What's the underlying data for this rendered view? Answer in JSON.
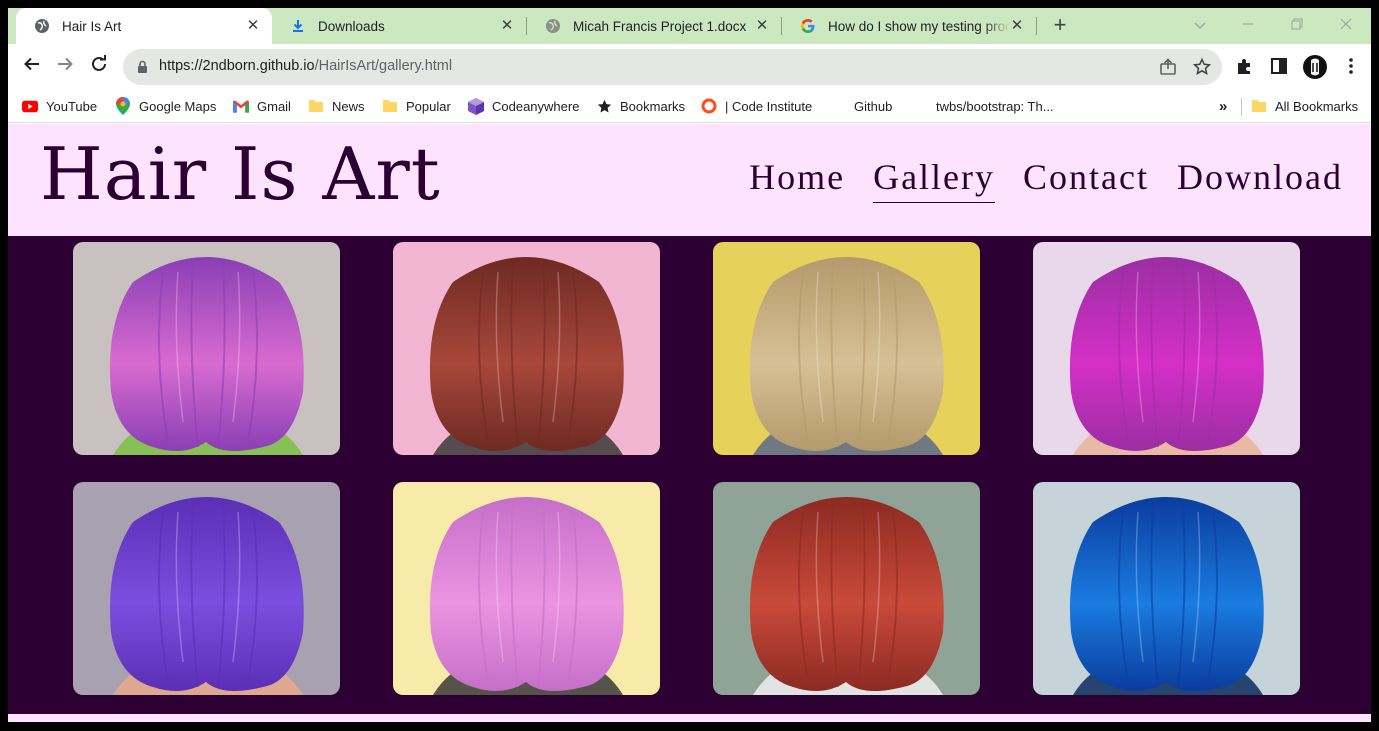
{
  "browser": {
    "tabs": [
      {
        "title": "Hair Is Art",
        "icon": "globe-icon",
        "active": true
      },
      {
        "title": "Downloads",
        "icon": "download-icon",
        "active": false
      },
      {
        "title": "Micah Francis Project 1.docx",
        "icon": "globe-icon",
        "active": false
      },
      {
        "title": "How do I show my testing proce",
        "icon": "google-icon",
        "active": false
      }
    ],
    "tab_close": "✕",
    "new_tab": "+",
    "url_host": "https://2ndborn.github.io",
    "url_path": "/HairIsArt/gallery.html",
    "bookmarks": [
      {
        "label": "YouTube",
        "icon": "youtube-icon"
      },
      {
        "label": "Google Maps",
        "icon": "maps-pin-icon"
      },
      {
        "label": "Gmail",
        "icon": "gmail-icon"
      },
      {
        "label": "News",
        "icon": "folder-icon"
      },
      {
        "label": "Popular",
        "icon": "folder-icon"
      },
      {
        "label": "Codeanywhere",
        "icon": "cube-icon"
      },
      {
        "label": "Bookmarks",
        "icon": "star-icon"
      },
      {
        "label": "| Code Institute",
        "icon": "ring-icon"
      },
      {
        "label": "Github",
        "icon": ""
      },
      {
        "label": "twbs/bootstrap: Th...",
        "icon": ""
      }
    ],
    "bookmarks_overflow": "»",
    "all_bookmarks": "All Bookmarks"
  },
  "site": {
    "logo": "Hair Is Art",
    "nav": [
      "Home",
      "Gallery",
      "Contact",
      "Download"
    ],
    "current_nav": "Gallery",
    "colors": {
      "header_bg": "#fde3fe",
      "page_bg": "#2d0034",
      "text": "#2d0034"
    }
  },
  "gallery": {
    "photos": [
      {
        "subject": "purple-pink bob with green streak",
        "hair": "#d86bd0",
        "hair2": "#8a3fb5",
        "bg": "#c9c0c0",
        "accent": "#7cc043"
      },
      {
        "subject": "auburn wavy bob",
        "hair": "#a8473a",
        "hair2": "#6e2a22",
        "bg": "#f3b6d2",
        "accent": "#3a3a3a"
      },
      {
        "subject": "straight blonde bob",
        "hair": "#d7c095",
        "hair2": "#b49a6c",
        "bg": "#e6d25a",
        "accent": "#5a6a8a"
      },
      {
        "subject": "magenta long hair with hand",
        "hair": "#d52fc7",
        "hair2": "#9b2ea3",
        "bg": "#e8d8ea",
        "accent": "#e8b59a"
      },
      {
        "subject": "violet bob with hand",
        "hair": "#7c4ee0",
        "hair2": "#5a2fb5",
        "bg": "#a8a2b0",
        "accent": "#e6a98a"
      },
      {
        "subject": "pink curly hair",
        "hair": "#ec93e2",
        "hair2": "#c56fc8",
        "bg": "#f8eaa8",
        "accent": "#3a3a3a"
      },
      {
        "subject": "red wavy hair",
        "hair": "#c94a3a",
        "hair2": "#8c2a22",
        "bg": "#8fa396",
        "accent": "#f0f0f0"
      },
      {
        "subject": "electric blue hair",
        "hair": "#1a7ce0",
        "hair2": "#0b3c9e",
        "bg": "#c6d4da",
        "accent": "#0a2a5a"
      }
    ]
  }
}
